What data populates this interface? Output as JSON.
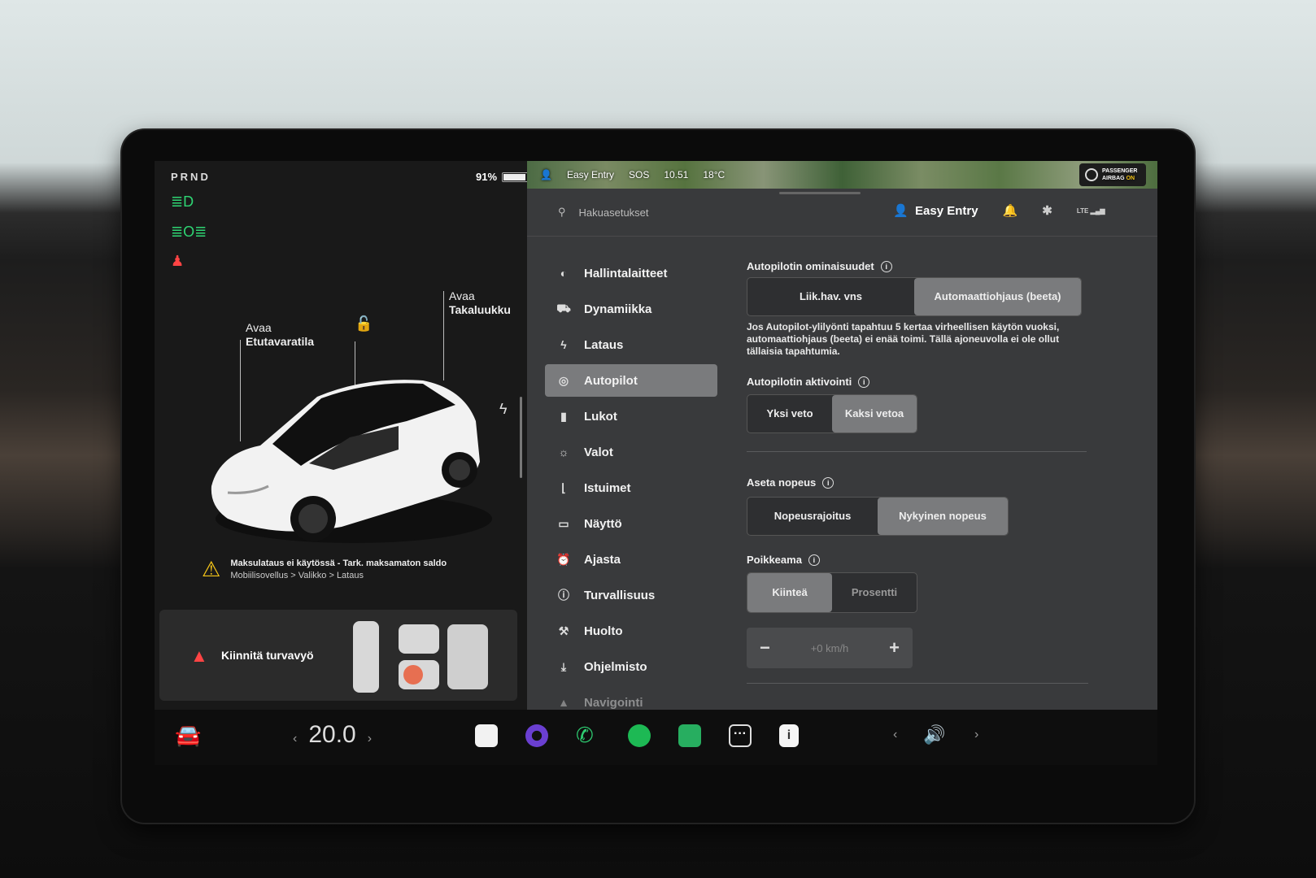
{
  "left_panel": {
    "gear": "PRND",
    "battery_percent": "91%",
    "battery_level": 0.91,
    "callouts": {
      "front_l1": "Avaa",
      "front_l2": "Etutavaratila",
      "rear_l1": "Avaa",
      "rear_l2": "Takaluukku"
    },
    "warning": {
      "line1": "Maksulataus ei käytössä - Tark. maksamaton saldo",
      "line2": "Mobiilisovellus > Valikko > Lataus"
    },
    "seatbelt": "Kiinnitä turvavyö"
  },
  "status_strip": {
    "profile": "Easy Entry",
    "sos": "SOS",
    "time": "10.51",
    "temp": "18°C",
    "airbag_l1": "PASSENGER",
    "airbag_l2": "AIRBAG",
    "airbag_state": "ON"
  },
  "header": {
    "search_placeholder": "Hakuasetukset",
    "profile": "Easy Entry",
    "lte": "LTE"
  },
  "menu": [
    {
      "label": "Hallintalaitteet",
      "icon": "toggle-icon"
    },
    {
      "label": "Dynamiikka",
      "icon": "car-icon"
    },
    {
      "label": "Lataus",
      "icon": "bolt-icon"
    },
    {
      "label": "Autopilot",
      "icon": "steering-wheel-icon"
    },
    {
      "label": "Lukot",
      "icon": "lock-icon"
    },
    {
      "label": "Valot",
      "icon": "sun-icon"
    },
    {
      "label": "Istuimet",
      "icon": "seat-icon"
    },
    {
      "label": "Näyttö",
      "icon": "display-icon"
    },
    {
      "label": "Ajasta",
      "icon": "alarm-icon"
    },
    {
      "label": "Turvallisuus",
      "icon": "safety-icon"
    },
    {
      "label": "Huolto",
      "icon": "wrench-icon"
    },
    {
      "label": "Ohjelmisto",
      "icon": "download-icon"
    },
    {
      "label": "Navigointi",
      "icon": "navigation-icon"
    }
  ],
  "active_menu": "Autopilot",
  "autopilot": {
    "features_title": "Autopilotin ominaisuudet",
    "features_options": [
      "Liik.hav. vns",
      "Automaattiohjaus (beeta)"
    ],
    "features_selected": "Automaattiohjaus (beeta)",
    "features_desc": "Jos Autopilot-ylilyönti tapahtuu 5 kertaa virheellisen käytön vuoksi, automaattiohjaus (beeta) ei enää toimi. Tällä ajoneuvolla ei ole ollut tällaisia tapahtumia.",
    "activation_title": "Autopilotin aktivointi",
    "activation_options": [
      "Yksi veto",
      "Kaksi vetoa"
    ],
    "activation_selected": "Kaksi vetoa",
    "speed_title": "Aseta nopeus",
    "speed_options": [
      "Nopeusrajoitus",
      "Nykyinen nopeus"
    ],
    "speed_selected": "Nykyinen nopeus",
    "offset_title": "Poikkeama",
    "offset_options": [
      "Kiinteä",
      "Prosentti"
    ],
    "offset_selected": "Kiinteä",
    "offset_value": "+0 km/h"
  },
  "dock": {
    "temperature": "20.0",
    "colors": {
      "camera": "#6a3fd1",
      "phone": "#2ecc71",
      "spotify": "#1db954",
      "chart": "#27ae60"
    }
  }
}
